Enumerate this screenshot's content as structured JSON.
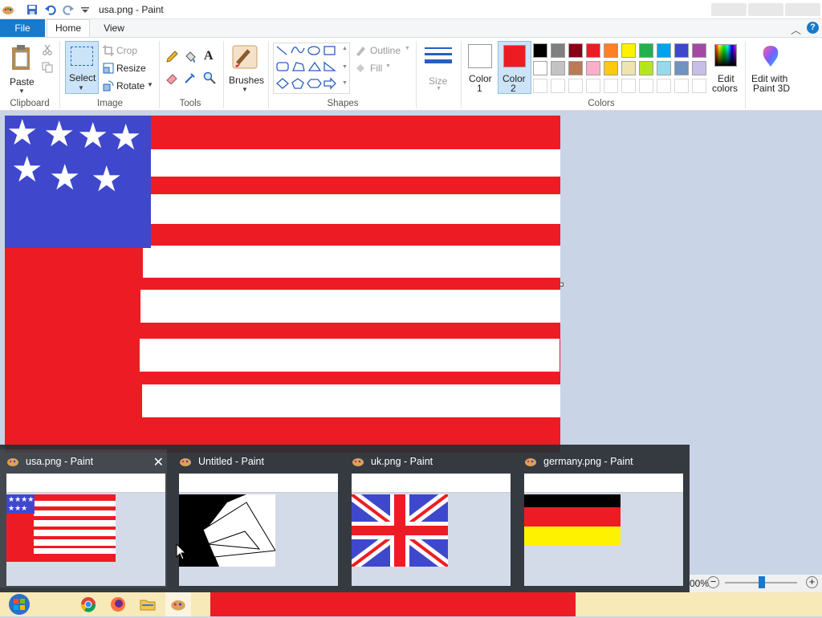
{
  "window": {
    "title": "usa.png - Paint"
  },
  "tabs": {
    "file": "File",
    "home": "Home",
    "view": "View"
  },
  "ribbon": {
    "clipboard": {
      "paste": "Paste",
      "group": "Clipboard"
    },
    "image": {
      "select": "Select",
      "crop": "Crop",
      "resize": "Resize",
      "rotate": "Rotate",
      "group": "Image"
    },
    "tools": {
      "group": "Tools",
      "text_tool": "A"
    },
    "brushes": {
      "label": "Brushes"
    },
    "shapes": {
      "outline": "Outline",
      "fill": "Fill",
      "group": "Shapes"
    },
    "size": {
      "label": "Size"
    },
    "colors": {
      "color1_line1": "Color",
      "color1_line2": "1",
      "color2_line1": "Color",
      "color2_line2": "2",
      "color1_value": "#ffffff",
      "color2_value": "#ed1c24",
      "edit_colors_line1": "Edit",
      "edit_colors_line2": "colors",
      "paint3d_line1": "Edit with",
      "paint3d_line2": "Paint 3D",
      "group": "Colors",
      "palette_row1": [
        "#000000",
        "#7f7f7f",
        "#880015",
        "#ed1c24",
        "#ff7f27",
        "#fff200",
        "#22b14c",
        "#00a2e8",
        "#3f48cc",
        "#a349a4"
      ],
      "palette_row2": [
        "#ffffff",
        "#c3c3c3",
        "#b97a57",
        "#ffaec9",
        "#ffc90e",
        "#efe4b0",
        "#b5e61d",
        "#99d9ea",
        "#7092be",
        "#c8bfe7"
      ]
    }
  },
  "thumbnails": [
    {
      "title": "usa.png - Paint"
    },
    {
      "title": "Untitled - Paint"
    },
    {
      "title": "uk.png - Paint"
    },
    {
      "title": "germany.png - Paint"
    }
  ],
  "status": {
    "zoom": "00%"
  },
  "flag_colors": {
    "red": "#ed1c24",
    "white": "#ffffff",
    "blue": "#3f48cc"
  }
}
